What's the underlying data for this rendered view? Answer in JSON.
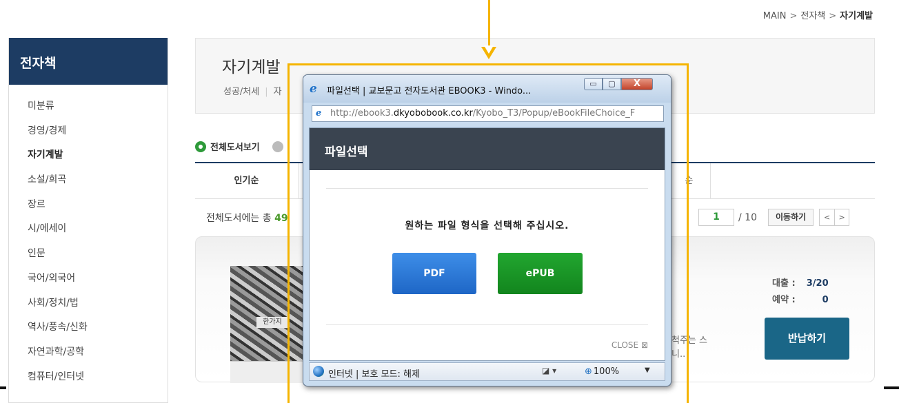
{
  "breadcrumb": {
    "home": "MAIN",
    "sep1": ">",
    "level1": "전자책",
    "sep2": ">",
    "current": "자기계발"
  },
  "sidebar": {
    "title": "전자책",
    "items": [
      {
        "label": "미분류"
      },
      {
        "label": "경영/경제"
      },
      {
        "label": "자기계발"
      },
      {
        "label": "소설/희곡"
      },
      {
        "label": "장르"
      },
      {
        "label": "시/에세이"
      },
      {
        "label": "인문"
      },
      {
        "label": "국어/외국어"
      },
      {
        "label": "사회/정치/법"
      },
      {
        "label": "역사/풍속/신화"
      },
      {
        "label": "자연과학/공학"
      },
      {
        "label": "컴퓨터/인터넷"
      }
    ],
    "active_index": 2
  },
  "content": {
    "title": "자기계발",
    "subcat1": "성공/처세",
    "subcat_sep": "|",
    "subcat2": "자",
    "view_all": "전체도서보기",
    "sort_first": "인기순",
    "sort_last": "순",
    "total_prefix": "전체도서에는 총",
    "total_frag": "49"
  },
  "pager": {
    "page": "1",
    "of": "/ 10",
    "go": "이동하기",
    "prev": "<",
    "next": ">"
  },
  "book": {
    "cover_label": "한가지",
    "loan_label": "대출 :",
    "loan_value": "3/20",
    "reserve_label": "예약 :",
    "reserve_value": "0",
    "return_button": "반납하기",
    "desc_line1": "척주는 스",
    "desc_line2": "니.."
  },
  "popup": {
    "window_title": "파일선택 | 교보문고 전자도서관 EBOOK3 - Windo...",
    "win_min": "▭",
    "win_max": "▢",
    "win_close": "X",
    "url_prefix": "http://ebook3.",
    "url_domain": "dkyobobook.co.kr",
    "url_path": "/Kyobo_T3/Popup/eBookFileChoice_F",
    "dialog_title": "파일선택",
    "message": "원하는 파일 형식을 선택해 주십시오.",
    "pdf_button": "PDF",
    "epub_button": "ePUB",
    "close_link": "CLOSE ⊠",
    "status_text": "인터넷 | 보호 모드: 해제",
    "security_icon": "◪ ▾",
    "zoom": "100%",
    "zoom_caret": "▼"
  },
  "colors": {
    "sidebar_head": "#1d3c63",
    "highlight": "#f5b400",
    "pdf": "#1e66c6",
    "epub": "#12851d",
    "return_button": "#1a6687"
  }
}
